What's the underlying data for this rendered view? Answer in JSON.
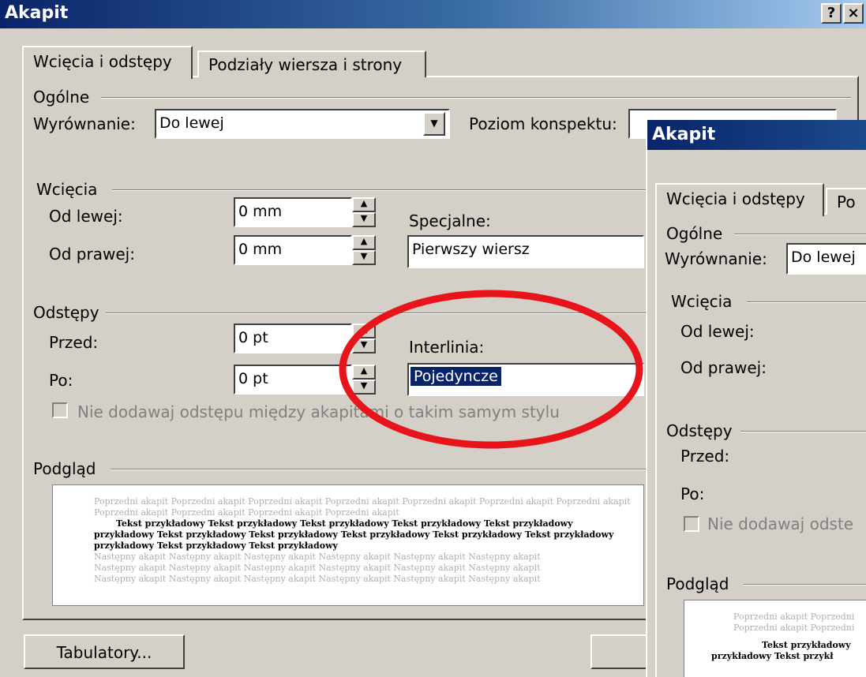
{
  "dialog_title": "Akapit",
  "title_buttons": {
    "help": "?",
    "close": "×"
  },
  "tabs": {
    "indents": "Wcięcia i odstępy",
    "breaks": "Podziały wiersza i strony",
    "breaks_partial": "Po"
  },
  "general": {
    "section": "Ogólne",
    "alignment_label": "Wyrównanie:",
    "alignment_value": "Do lewej",
    "alignment_value_partial": "Do lewej",
    "outline_label": "Poziom konspektu:"
  },
  "indents": {
    "section": "Wcięcia",
    "left_label": "Od lewej:",
    "left_value": "0 mm",
    "right_label": "Od prawej:",
    "right_value": "0 mm",
    "special_label": "Specjalne:",
    "special_value": "Pierwszy wiersz"
  },
  "spacing": {
    "section": "Odstępy",
    "before_label": "Przed:",
    "before_value": "0 pt",
    "after_label": "Po:",
    "after_value": "0 pt",
    "line_label": "Interlinia:",
    "line_value": "Pojedyncze",
    "no_space_label": "Nie dodawaj odstępu między akapitami o takim samym stylu",
    "no_space_partial": "Nie dodawaj odste"
  },
  "preview": {
    "section": "Podgląd",
    "prev_line1": "Poprzedni akapit Poprzedni akapit Poprzedni akapit Poprzedni akapit Poprzedni akapit Poprzedni akapit Poprzedni akapit",
    "prev_line2": "Poprzedni akapit Poprzedni akapit Poprzedni akapit Poprzedni akapit",
    "sample_line1": "Tekst przykładowy Tekst przykładowy Tekst przykładowy Tekst przykładowy Tekst przykładowy",
    "sample_line2": "przykładowy Tekst przykładowy Tekst przykładowy Tekst przykładowy Tekst przykładowy Tekst przykładowy",
    "sample_line3": "przykładowy Tekst przykładowy Tekst przykładowy",
    "next_line1": "Następny akapit Następny akapit Następny akapit Następny akapit Następny akapit Następny akapit",
    "next_line2": "Następny akapit Następny akapit Następny akapit Następny akapit Następny akapit Następny akapit",
    "next_line3": "Następny akapit Następny akapit Następny akapit Następny akapit Następny akapit Następny akapit",
    "p_prev1": "Poprzedni akapit Poprzedni",
    "p_prev2": "Poprzedni akapit Poprzedni",
    "p_sample1": "Tekst przykładowy",
    "p_sample2": "przykładowy Tekst przykł"
  },
  "buttons": {
    "tabs": "Tabulatory..."
  },
  "annotation_color": "#e8141b"
}
